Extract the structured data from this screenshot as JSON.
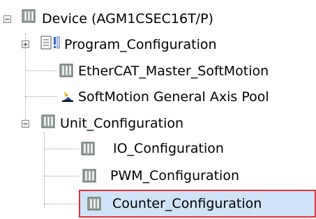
{
  "tree": {
    "root": {
      "label": "Device (AGM1CSEC16T/P)",
      "icon": "device-icon",
      "expanded": true
    },
    "children": [
      {
        "label": "Program_Configuration",
        "icon": "program-config-icon",
        "expanded": false
      },
      {
        "label": "EtherCAT_Master_SoftMotion",
        "icon": "device-icon"
      },
      {
        "label": "SoftMotion General Axis Pool",
        "icon": "axis-pool-icon"
      },
      {
        "label": "Unit_Configuration",
        "icon": "device-icon",
        "expanded": true,
        "children": [
          {
            "label": "IO_Configuration",
            "icon": "device-icon"
          },
          {
            "label": "PWM_Configuration",
            "icon": "device-icon"
          },
          {
            "label": "Counter_Configuration",
            "icon": "device-icon",
            "selected": true
          }
        ]
      }
    ],
    "toggle_expanded": "−",
    "toggle_collapsed": "+"
  },
  "colors": {
    "selection_background": "#cfe3f7",
    "selection_border": "#e0303a",
    "tree_lines": "#a0a0a0"
  }
}
